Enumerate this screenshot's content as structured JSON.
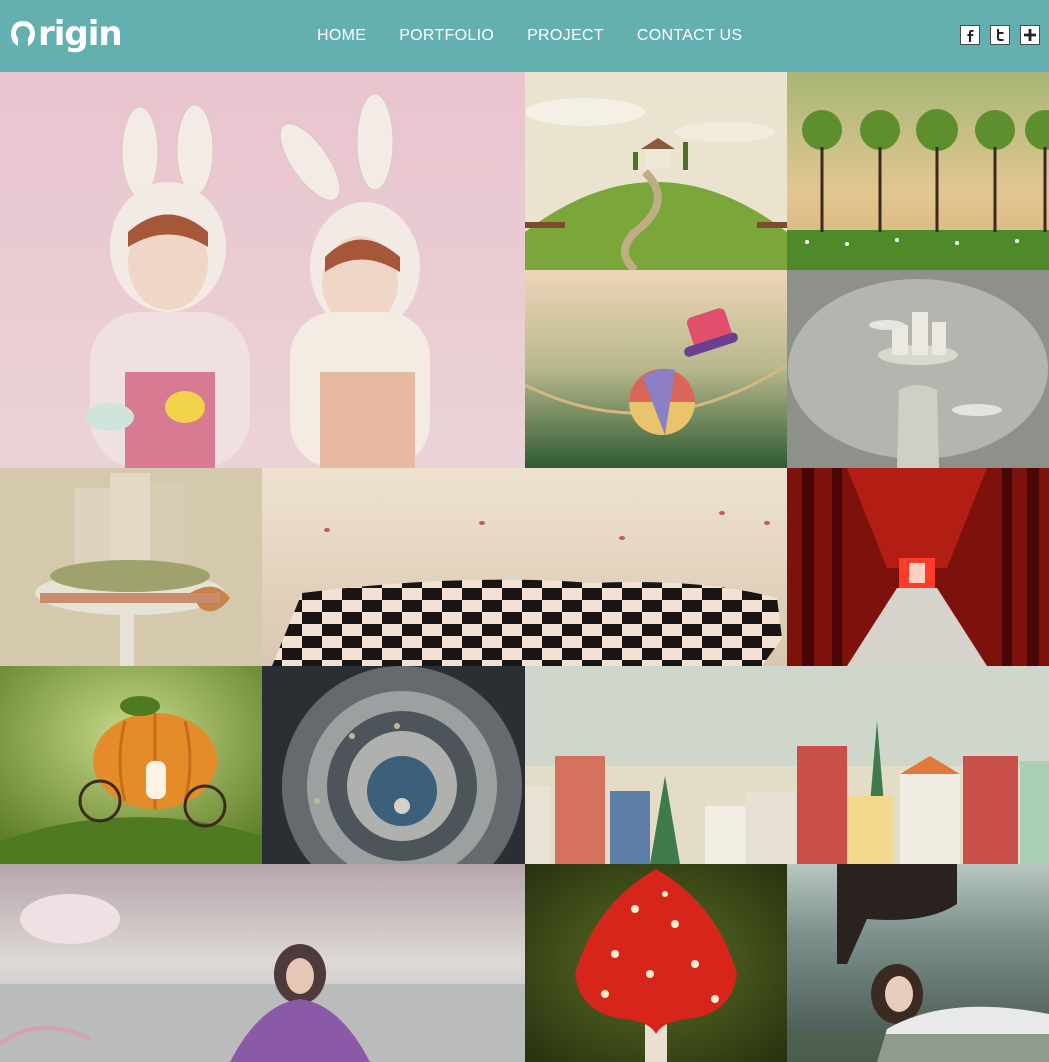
{
  "brand": {
    "name": "rigin",
    "logo_icon": "origin-o-mark"
  },
  "nav": {
    "items": [
      {
        "label": "HOME"
      },
      {
        "label": "PORTFOLIO"
      },
      {
        "label": "PROJECT"
      },
      {
        "label": "CONTACT US"
      }
    ]
  },
  "social": [
    {
      "icon": "facebook-icon",
      "glyph": "f"
    },
    {
      "icon": "twitter-icon",
      "glyph": "t"
    },
    {
      "icon": "plus-icon",
      "glyph": "+"
    }
  ],
  "gallery": {
    "images": [
      {
        "subject": "bunny-girls"
      },
      {
        "subject": "house-on-hill"
      },
      {
        "subject": "tree-row"
      },
      {
        "subject": "hat-and-ball"
      },
      {
        "subject": "tower-castle"
      },
      {
        "subject": "castle-cake"
      },
      {
        "subject": "chessboard"
      },
      {
        "subject": "red-torii"
      },
      {
        "subject": "pumpkin-carriage"
      },
      {
        "subject": "spiral-staircase"
      },
      {
        "subject": "toy-town"
      },
      {
        "subject": "girl-in-mist"
      },
      {
        "subject": "mushroom"
      },
      {
        "subject": "girl-in-grass"
      }
    ]
  },
  "colors": {
    "header": "#64afaf",
    "text": "#ffffff"
  }
}
